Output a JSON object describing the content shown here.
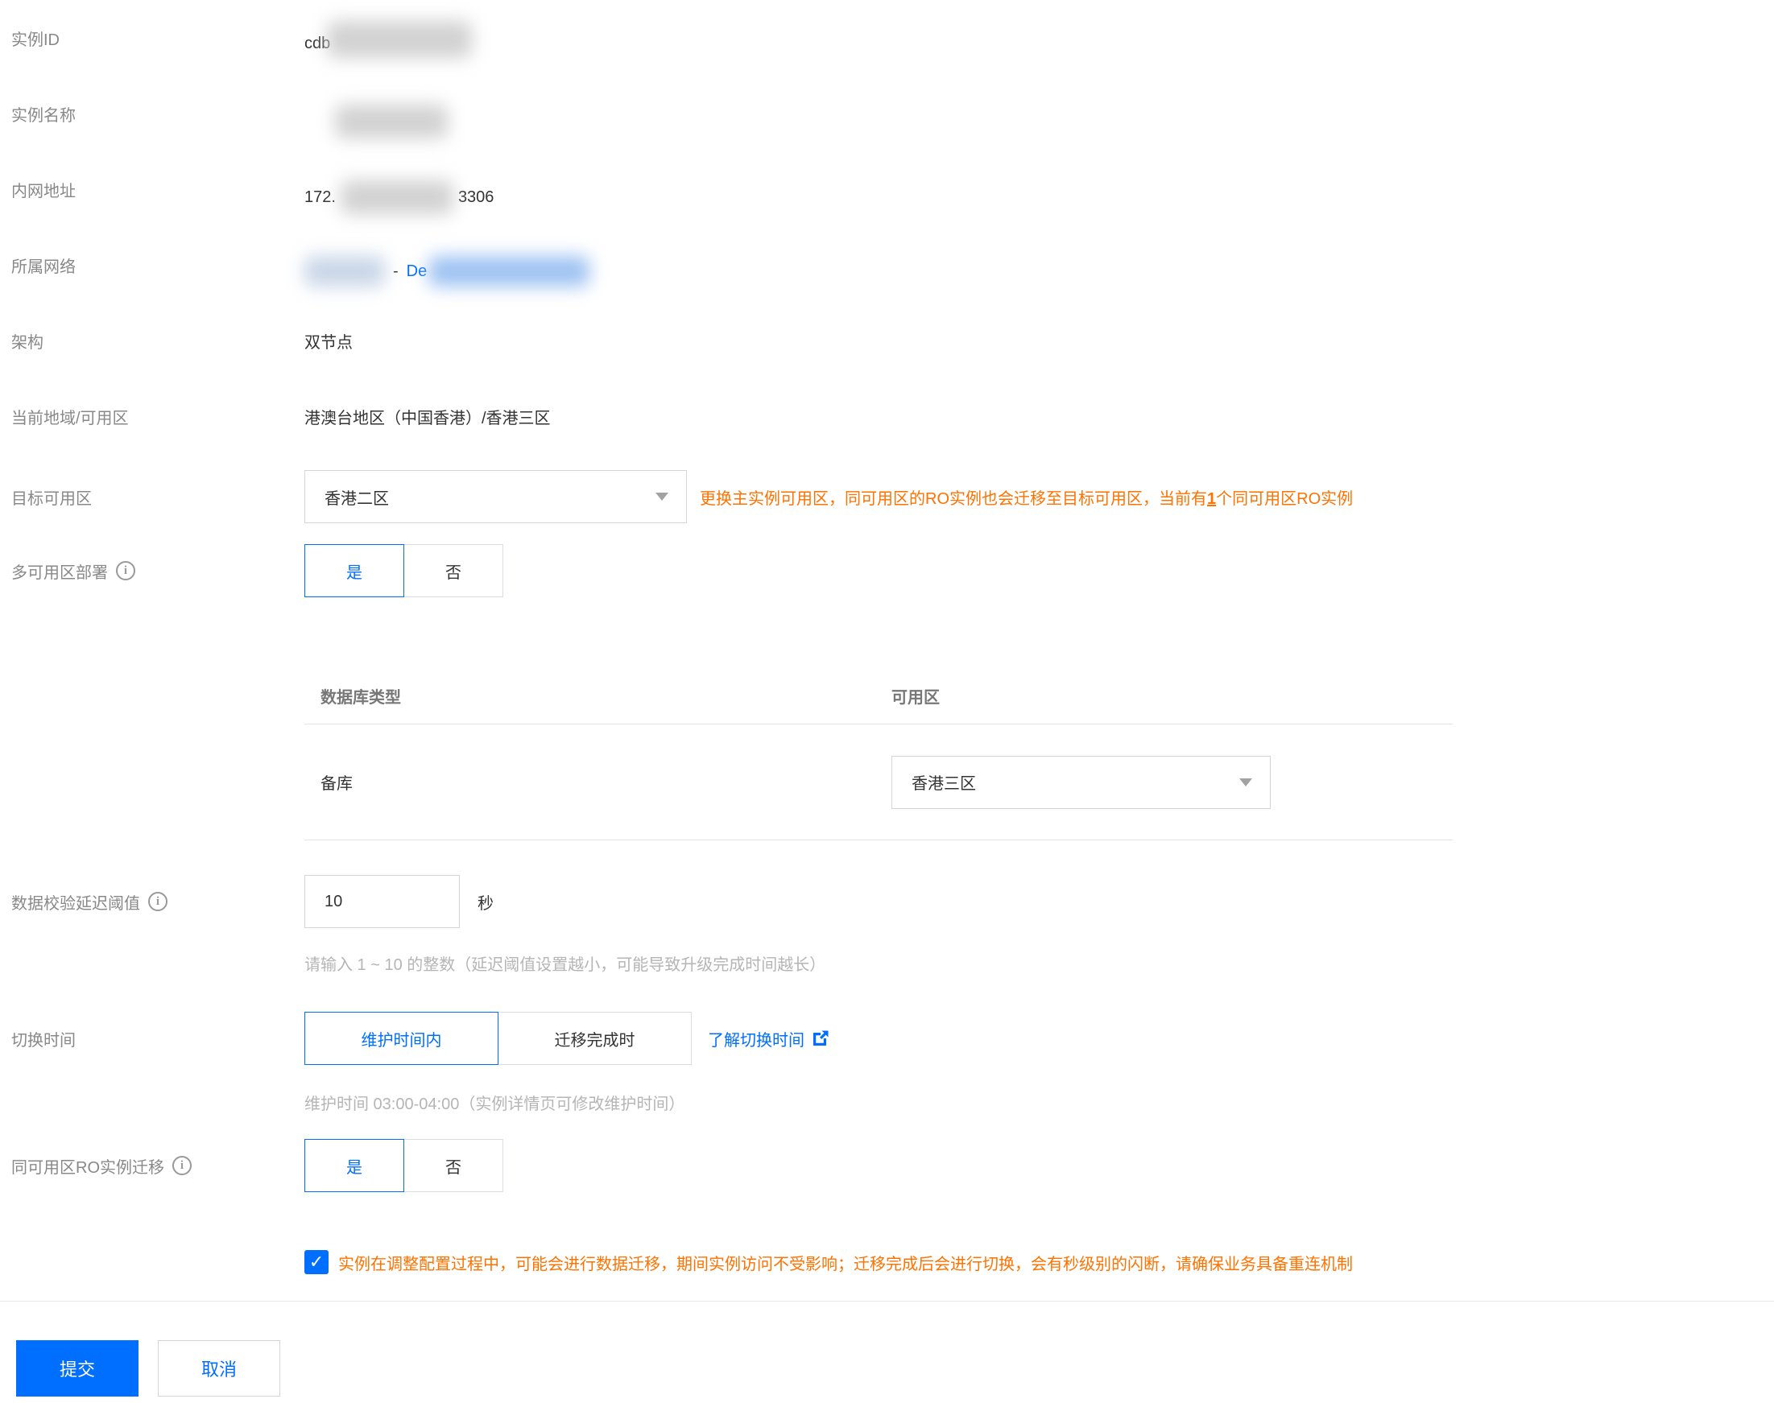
{
  "colors": {
    "accent": "#006eff",
    "warning": "#ff7200",
    "label_grey": "#888888",
    "text": "#333333",
    "hint_grey": "#b5b5b5"
  },
  "fields": {
    "instance_id": {
      "label": "实例ID",
      "value_prefix": "cdb"
    },
    "instance_name": {
      "label": "实例名称"
    },
    "private_address": {
      "label": "内网地址",
      "value_prefix": "172.",
      "value_suffix": "3306"
    },
    "network": {
      "label": "所属网络",
      "separator": "-",
      "link_prefix": "De"
    },
    "architecture": {
      "label": "架构",
      "value": "双节点"
    },
    "current_region": {
      "label": "当前地域/可用区",
      "value": "港澳台地区（中国香港）/香港三区"
    },
    "target_zone": {
      "label": "目标可用区",
      "selected": "香港二区",
      "warning_before": "更换主实例可用区，同可用区的RO实例也会迁移至目标可用区，当前有",
      "warning_count": "1",
      "warning_after": "个同可用区RO实例"
    },
    "multi_zone": {
      "label": "多可用区部署",
      "yes": "是",
      "no": "否",
      "selected": "是"
    },
    "zone_table": {
      "headers": [
        "数据库类型",
        "可用区"
      ],
      "rows": [
        {
          "db_type": "备库",
          "zone": "香港三区"
        }
      ]
    },
    "delay_threshold": {
      "label": "数据校验延迟阈值",
      "value": "10",
      "unit": "秒",
      "hint": "请输入 1 ~ 10 的整数（延迟阈值设置越小，可能导致升级完成时间越长）"
    },
    "switch_time": {
      "label": "切换时间",
      "option_maintenance": "维护时间内",
      "option_on_complete": "迁移完成时",
      "selected": "维护时间内",
      "link_label": "了解切换时间",
      "hint": "维护时间 03:00-04:00（实例详情页可修改维护时间）"
    },
    "ro_migration": {
      "label": "同可用区RO实例迁移",
      "yes": "是",
      "no": "否",
      "selected": "是"
    },
    "notice": "实例在调整配置过程中，可能会进行数据迁移，期间实例访问不受影响；迁移完成后会进行切换，会有秒级别的闪断，请确保业务具备重连机制"
  },
  "actions": {
    "submit": "提交",
    "cancel": "取消"
  }
}
